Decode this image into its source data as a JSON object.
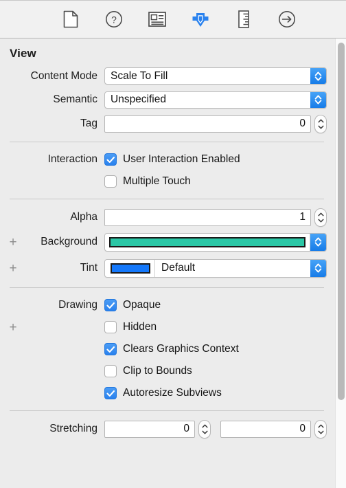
{
  "toolbar": {
    "items": [
      {
        "name": "file-inspector-icon",
        "label": "File inspector",
        "selected": false
      },
      {
        "name": "quick-help-icon",
        "label": "Quick Help inspector",
        "selected": false
      },
      {
        "name": "identity-inspector-icon",
        "label": "Identity inspector",
        "selected": false
      },
      {
        "name": "attributes-inspector-icon",
        "label": "Attributes inspector",
        "selected": true
      },
      {
        "name": "size-inspector-icon",
        "label": "Size inspector",
        "selected": false
      },
      {
        "name": "connections-inspector-icon",
        "label": "Connections inspector",
        "selected": false
      }
    ],
    "selected_index": 3,
    "accent_color": "#2a82ee"
  },
  "panel": {
    "section_title": "View",
    "rows": {
      "content_mode": {
        "label": "Content Mode",
        "value": "Scale To Fill"
      },
      "semantic": {
        "label": "Semantic",
        "value": "Unspecified"
      },
      "tag": {
        "label": "Tag",
        "value": "0"
      },
      "interaction": {
        "label": "Interaction"
      },
      "user_interaction_enabled": {
        "label": "User Interaction Enabled",
        "checked": true
      },
      "multiple_touch": {
        "label": "Multiple Touch",
        "checked": false
      },
      "alpha": {
        "label": "Alpha",
        "value": "1"
      },
      "background": {
        "label": "Background",
        "color": "#2bc7a6",
        "plus": "+"
      },
      "tint": {
        "label": "Tint",
        "value": "Default",
        "color": "#1478fb",
        "plus": "+"
      },
      "drawing": {
        "label": "Drawing",
        "plus": "+"
      },
      "opaque": {
        "label": "Opaque",
        "checked": true
      },
      "hidden": {
        "label": "Hidden",
        "checked": false
      },
      "clears_graphics_context": {
        "label": "Clears Graphics Context",
        "checked": true
      },
      "clip_to_bounds": {
        "label": "Clip to Bounds",
        "checked": false
      },
      "autoresize_subviews": {
        "label": "Autoresize Subviews",
        "checked": true
      },
      "stretching": {
        "label": "Stretching",
        "value_x": "0",
        "value_y": "0"
      }
    }
  }
}
